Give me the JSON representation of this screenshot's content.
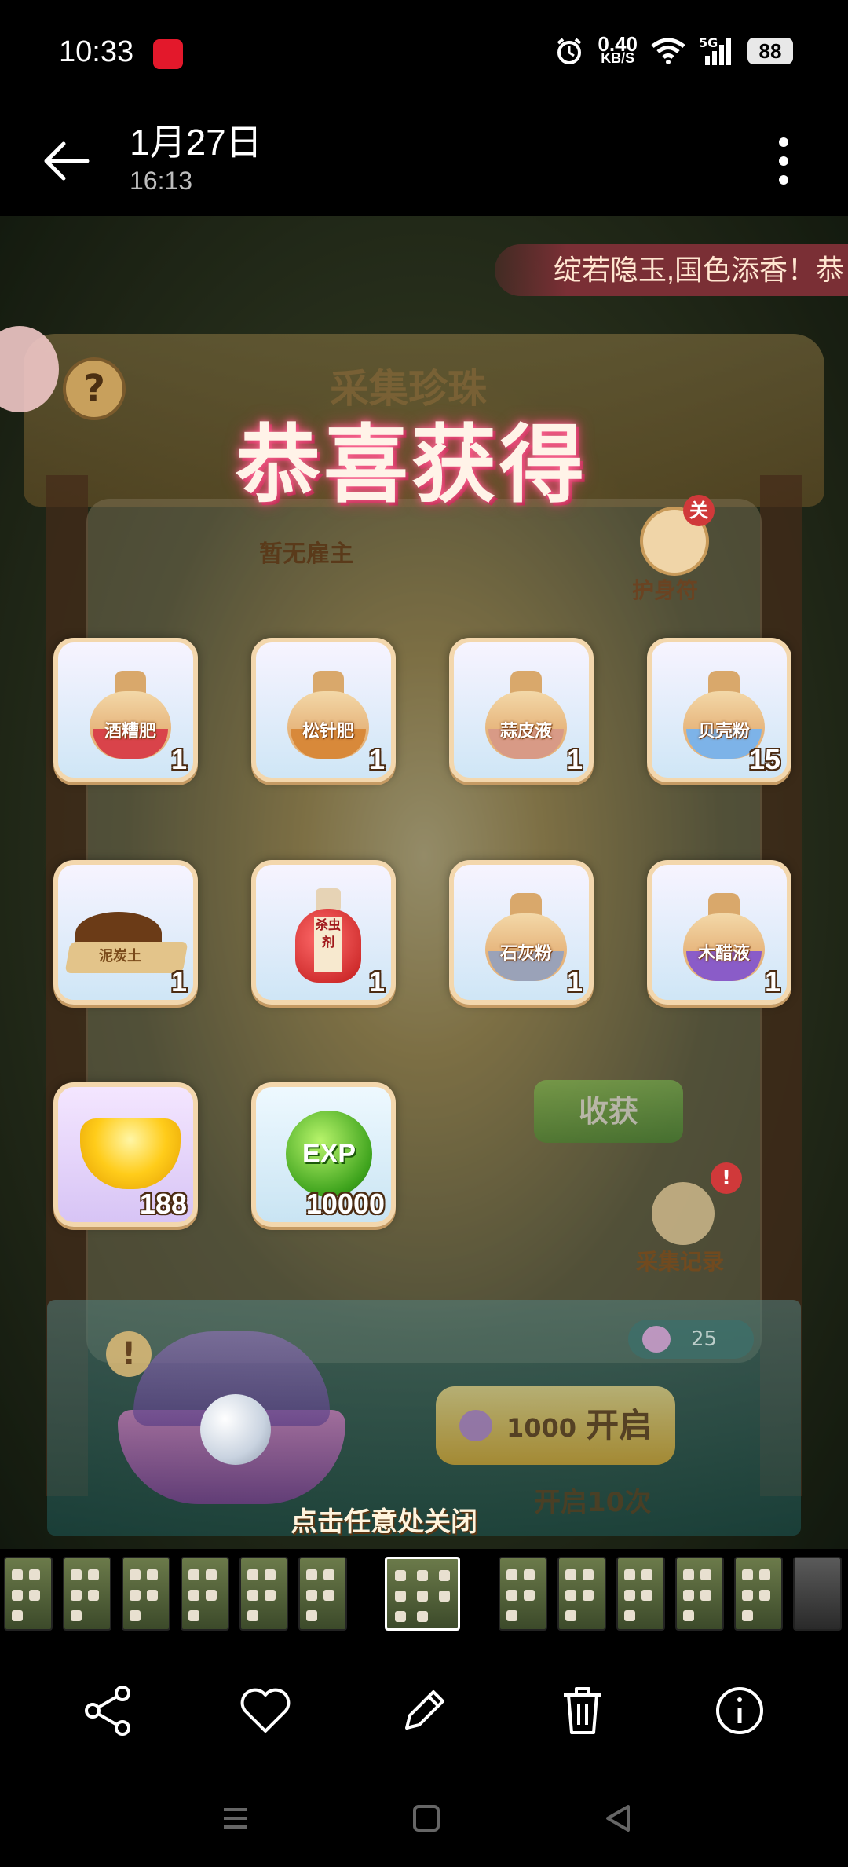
{
  "status_bar": {
    "time": "10:33",
    "net_speed_value": "0.40",
    "net_speed_unit": "KB/S",
    "signal": "5G",
    "battery": "88"
  },
  "header": {
    "title": "1月27日",
    "subtitle": "16:13"
  },
  "game": {
    "banner_text": "绽若隐玉,国色添香！恭",
    "panel_title": "采集珍珠",
    "congrats_title": "恭喜获得",
    "no_employer": "暂无雇主",
    "charm_label": "护身符",
    "charm_badge": "关",
    "items": [
      {
        "name": "酒糟肥",
        "qty": "1",
        "color": "#d9434a"
      },
      {
        "name": "松针肥",
        "qty": "1",
        "color": "#d8893a"
      },
      {
        "name": "蒜皮液",
        "qty": "1",
        "color": "#d89a86"
      },
      {
        "name": "贝壳粉",
        "qty": "15",
        "color": "#7db3e8"
      },
      {
        "name": "泥炭土",
        "qty": "1",
        "color": ""
      },
      {
        "name": "杀虫剂",
        "qty": "1",
        "color": "#c21c1c"
      },
      {
        "name": "石灰粉",
        "qty": "1",
        "color": "#9aa2b8"
      },
      {
        "name": "木醋液",
        "qty": "1",
        "color": "#8a5cc8"
      },
      {
        "name": "",
        "qty": "188",
        "color": "#ffcc1a"
      },
      {
        "name": "EXP",
        "qty": "10000",
        "color": "#3ea31d"
      }
    ],
    "harvest_button": "收获",
    "record_label": "采集记录",
    "record_badge": "!",
    "pearl_count": "25",
    "open_cost": "1000",
    "open_label": "开启",
    "open_ten": "开启10次",
    "close_hint": "点击任意处关闭",
    "help": "?",
    "warn": "!"
  },
  "icons": {
    "back": "arrow-left-icon",
    "more": "more-vertical-icon",
    "share": "share-icon",
    "favorite": "heart-icon",
    "edit": "pencil-icon",
    "delete": "trash-icon",
    "info": "info-icon"
  }
}
